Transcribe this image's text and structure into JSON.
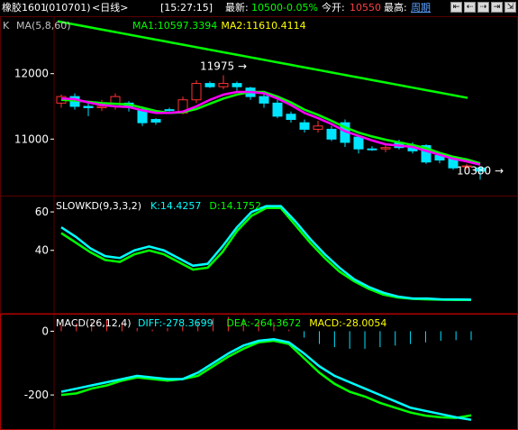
{
  "header": {
    "instrument": "橡胶1601",
    "code": "(010701)",
    "period": "<日线>",
    "time": "[15:27:15]",
    "latest_label": "最新:",
    "latest_value": "10500",
    "change_pct": "-0.05%",
    "open_label": "今开:",
    "open_value": "10550",
    "high_label": "最高:",
    "period_link": "周期"
  },
  "colors": {
    "up": "#ff3232",
    "down": "#00e4ff",
    "ma1": "#ff00ff",
    "ma2": "#00ff00",
    "k_line": "#00ffff",
    "d_line": "#00ff00",
    "macd_red": "#ff3232",
    "macd_cyan": "#00e4ff",
    "grid": "#5a0000",
    "axis_text": "#ffffff",
    "title_label": "#c0c0c0",
    "ma1_text": "#00ff00",
    "ma2_text": "#ffff00"
  },
  "chart_data": [
    {
      "type": "candlestick",
      "title_label": "K",
      "indicator": "MA(5,8,60)",
      "legend": [
        {
          "label": "MA1:10597.3394",
          "color": "#00ff00"
        },
        {
          "label": "MA2:11610.4114",
          "color": "#ffff00"
        }
      ],
      "y_ticks": [
        12000,
        11000
      ],
      "ylim": [
        10150,
        12850
      ],
      "annotations": [
        {
          "text": "11975",
          "x_index": 12,
          "y": 11975,
          "arrow": "→"
        },
        {
          "text": "10380",
          "x_index": 31,
          "y": 10380,
          "arrow": "→"
        }
      ],
      "candles": [
        {
          "o": 11550,
          "c": 11650,
          "h": 11680,
          "l": 11480
        },
        {
          "o": 11650,
          "c": 11500,
          "h": 11700,
          "l": 11450
        },
        {
          "o": 11500,
          "c": 11480,
          "h": 11560,
          "l": 11350
        },
        {
          "o": 11480,
          "c": 11500,
          "h": 11600,
          "l": 11430
        },
        {
          "o": 11500,
          "c": 11650,
          "h": 11700,
          "l": 11450
        },
        {
          "o": 11550,
          "c": 11500,
          "h": 11580,
          "l": 11420
        },
        {
          "o": 11450,
          "c": 11250,
          "h": 11500,
          "l": 11200
        },
        {
          "o": 11300,
          "c": 11260,
          "h": 11320,
          "l": 11220
        },
        {
          "o": 11450,
          "c": 11450,
          "h": 11480,
          "l": 11420
        },
        {
          "o": 11400,
          "c": 11600,
          "h": 11650,
          "l": 11380
        },
        {
          "o": 11600,
          "c": 11850,
          "h": 11900,
          "l": 11550
        },
        {
          "o": 11850,
          "c": 11800,
          "h": 11880,
          "l": 11780
        },
        {
          "o": 11800,
          "c": 11850,
          "h": 11975,
          "l": 11760
        },
        {
          "o": 11850,
          "c": 11800,
          "h": 11880,
          "l": 11740
        },
        {
          "o": 11780,
          "c": 11650,
          "h": 11800,
          "l": 11600
        },
        {
          "o": 11650,
          "c": 11550,
          "h": 11700,
          "l": 11480
        },
        {
          "o": 11550,
          "c": 11350,
          "h": 11600,
          "l": 11320
        },
        {
          "o": 11380,
          "c": 11300,
          "h": 11420,
          "l": 11250
        },
        {
          "o": 11250,
          "c": 11150,
          "h": 11300,
          "l": 11100
        },
        {
          "o": 11150,
          "c": 11200,
          "h": 11280,
          "l": 11100
        },
        {
          "o": 11150,
          "c": 11000,
          "h": 11200,
          "l": 10970
        },
        {
          "o": 11250,
          "c": 10950,
          "h": 11300,
          "l": 10880
        },
        {
          "o": 11030,
          "c": 10850,
          "h": 11050,
          "l": 10780
        },
        {
          "o": 10850,
          "c": 10850,
          "h": 10890,
          "l": 10820
        },
        {
          "o": 10850,
          "c": 10870,
          "h": 10900,
          "l": 10800
        },
        {
          "o": 10950,
          "c": 10870,
          "h": 10990,
          "l": 10840
        },
        {
          "o": 10900,
          "c": 10820,
          "h": 10950,
          "l": 10780
        },
        {
          "o": 10900,
          "c": 10650,
          "h": 10920,
          "l": 10620
        },
        {
          "o": 10750,
          "c": 10680,
          "h": 10780,
          "l": 10630
        },
        {
          "o": 10700,
          "c": 10560,
          "h": 10730,
          "l": 10530
        },
        {
          "o": 10580,
          "c": 10590,
          "h": 10620,
          "l": 10530
        },
        {
          "o": 10560,
          "c": 10510,
          "h": 10580,
          "l": 10380
        }
      ],
      "ma1": [
        11620,
        11610,
        11560,
        11520,
        11500,
        11490,
        11440,
        11400,
        11400,
        11420,
        11500,
        11600,
        11680,
        11720,
        11720,
        11700,
        11620,
        11520,
        11400,
        11320,
        11230,
        11120,
        11050,
        10980,
        10920,
        10900,
        10880,
        10820,
        10760,
        10700,
        10660,
        10610
      ],
      "ma2": [
        11600,
        11590,
        11570,
        11550,
        11540,
        11530,
        11480,
        11430,
        11400,
        11410,
        11460,
        11540,
        11620,
        11680,
        11720,
        11720,
        11650,
        11560,
        11450,
        11370,
        11280,
        11180,
        11100,
        11040,
        10990,
        10950,
        10910,
        10860,
        10790,
        10730,
        10690,
        10630
      ],
      "ma60": [
        12800,
        12770,
        12740,
        12710,
        12680,
        12650,
        12620,
        12590,
        12560,
        12530,
        12500,
        12470,
        12440,
        12410,
        12380,
        12350,
        12320,
        12290,
        12260,
        12230,
        12200,
        12170,
        12140,
        12110,
        12080,
        12050,
        12020,
        11990,
        11960,
        11930,
        11900,
        11870,
        11840,
        11810,
        11780,
        11750,
        11720,
        11690,
        11660,
        11630
      ]
    },
    {
      "type": "line",
      "title": "SLOWKD(9,3,3,2)",
      "legend": [
        {
          "label": "K:14.4257",
          "color": "#00ffff"
        },
        {
          "label": "D:14.1752",
          "color": "#00ff00"
        }
      ],
      "y_ticks": [
        60,
        40
      ],
      "ylim": [
        8,
        68
      ],
      "k": [
        52,
        47,
        41,
        37,
        36,
        40,
        42,
        40,
        36,
        32,
        33,
        42,
        52,
        60,
        63,
        63,
        55,
        46,
        38,
        31,
        25,
        21,
        18,
        16,
        15,
        15,
        14.5,
        14.5,
        14.4
      ],
      "d": [
        49,
        44,
        39,
        35,
        34,
        38,
        40,
        38,
        34,
        30,
        31,
        39,
        50,
        58,
        62,
        62,
        53,
        44,
        36,
        29,
        24,
        20,
        17,
        15.5,
        14.8,
        14.5,
        14.3,
        14.2,
        14.2
      ]
    },
    {
      "type": "line",
      "title": "MACD(26,12,4)",
      "legend": [
        {
          "label": "DIFF:-278.3699",
          "color": "#00ffff"
        },
        {
          "label": "DEA:-264.3672",
          "color": "#00ff00"
        },
        {
          "label": "MACD:-28.0054",
          "color": "#ffff00"
        }
      ],
      "y_ticks": [
        0,
        -200
      ],
      "ylim": [
        -310,
        55
      ],
      "diff": [
        -190,
        -180,
        -170,
        -160,
        -150,
        -140,
        -145,
        -150,
        -150,
        -130,
        -100,
        -70,
        -45,
        -30,
        -25,
        -35,
        -70,
        -110,
        -140,
        -160,
        -180,
        -200,
        -220,
        -240,
        -250,
        -260,
        -270,
        -278
      ],
      "dea": [
        -200,
        -195,
        -180,
        -170,
        -155,
        -145,
        -150,
        -155,
        -150,
        -140,
        -110,
        -80,
        -55,
        -35,
        -30,
        -40,
        -85,
        -130,
        -165,
        -190,
        -205,
        -225,
        -240,
        -255,
        -265,
        -270,
        -272,
        -264
      ],
      "macd": [
        20,
        25,
        30,
        35,
        28,
        10,
        5,
        10,
        15,
        30,
        40,
        45,
        40,
        35,
        28,
        5,
        -20,
        -40,
        -50,
        -55,
        -55,
        -50,
        -45,
        -40,
        -35,
        -30,
        -28,
        -28
      ]
    }
  ]
}
